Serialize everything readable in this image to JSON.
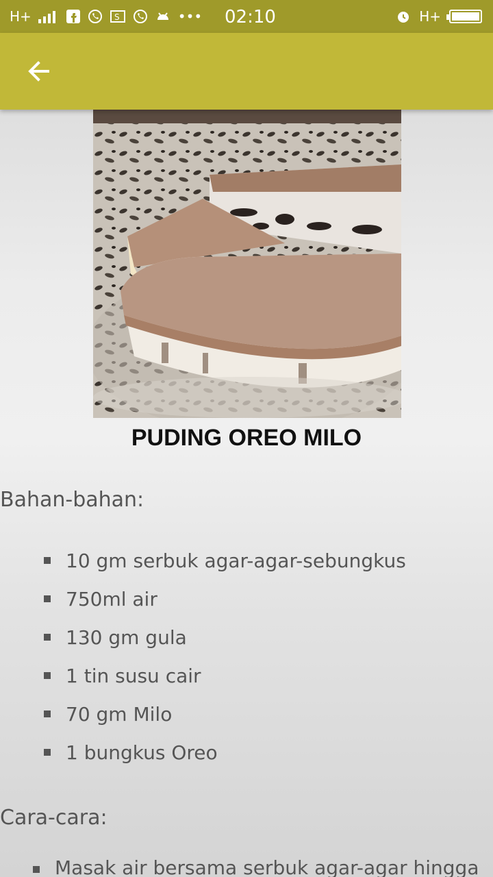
{
  "status_bar": {
    "network_left": "H+",
    "time": "02:10",
    "network_right": "H+"
  },
  "app_bar": {
    "back_icon": "arrow-left-icon"
  },
  "recipe": {
    "title": "PUDING OREO MILO",
    "ingredients_label": "Bahan-bahan:",
    "ingredients": [
      "10 gm serbuk agar-agar-sebungkus",
      "750ml air",
      "130 gm gula",
      "1 tin susu cair",
      "70 gm Milo",
      "1 bungkus Oreo"
    ],
    "steps_label": "Cara-cara:",
    "steps": [
      "Masak air bersama serbuk agar-agar hingga"
    ]
  },
  "colors": {
    "status_bar": "#9f9a2a",
    "app_bar": "#c1b838"
  }
}
